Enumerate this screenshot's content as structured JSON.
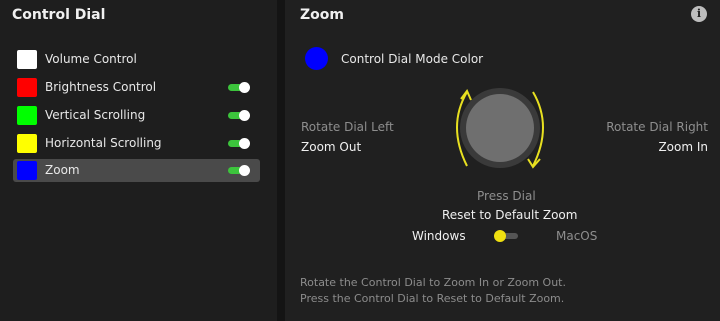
{
  "left_panel": {
    "title": "Control Dial",
    "modes": [
      {
        "label": "Volume Control",
        "color": "#ffffff",
        "toggle": null,
        "selected": false
      },
      {
        "label": "Brightness Control",
        "color": "#ff0000",
        "toggle": true,
        "selected": false
      },
      {
        "label": "Vertical Scrolling",
        "color": "#00ff00",
        "toggle": true,
        "selected": false
      },
      {
        "label": "Horizontal Scrolling",
        "color": "#ffff00",
        "toggle": true,
        "selected": false
      },
      {
        "label": "Zoom",
        "color": "#0000ff",
        "toggle": true,
        "selected": true
      }
    ]
  },
  "right_panel": {
    "title": "Zoom",
    "info_icon": "info-icon",
    "mode_color_label": "Control Dial Mode Color",
    "mode_color": "#0000ff",
    "rotate_left_label": "Rotate Dial Left",
    "rotate_left_action": "Zoom Out",
    "rotate_right_label": "Rotate Dial Right",
    "rotate_right_action": "Zoom In",
    "press_label": "Press Dial",
    "press_action": "Reset to Default Zoom",
    "os_left": "Windows",
    "os_right": "MacOS",
    "os_selected": "Windows",
    "help_line1": "Rotate the Control Dial to Zoom In or Zoom Out.",
    "help_line2": "Press the Control Dial to Reset to Default Zoom."
  },
  "colors": {
    "toggle_on": "#3cc43c",
    "arrow": "#e8e020",
    "os_knob": "#f0e010"
  }
}
